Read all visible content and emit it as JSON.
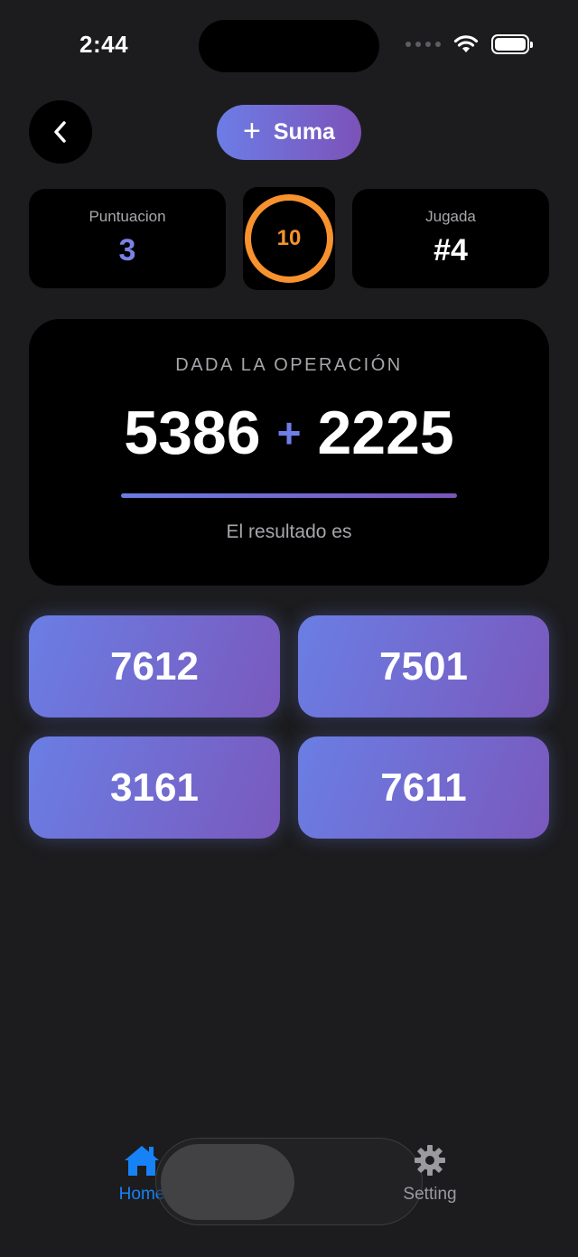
{
  "status_bar": {
    "time": "2:44"
  },
  "header": {
    "mode_label": "Suma"
  },
  "stats": {
    "score_label": "Puntuacion",
    "score_value": "3",
    "timer_value": "10",
    "play_label": "Jugada",
    "play_value": "#4"
  },
  "operation": {
    "title": "DADA LA OPERACIÓN",
    "operand_a": "5386",
    "operator": "+",
    "operand_b": "2225",
    "subtitle": "El resultado es"
  },
  "answers": [
    "7612",
    "7501",
    "3161",
    "7611"
  ],
  "tab_bar": {
    "home_label": "Home",
    "setting_label": "Setting",
    "active": "home"
  },
  "colors": {
    "accent_blue": "#1682f5",
    "timer_orange": "#f7922e",
    "gradient_start": "#6a7ee4",
    "gradient_end": "#7a59bd"
  }
}
